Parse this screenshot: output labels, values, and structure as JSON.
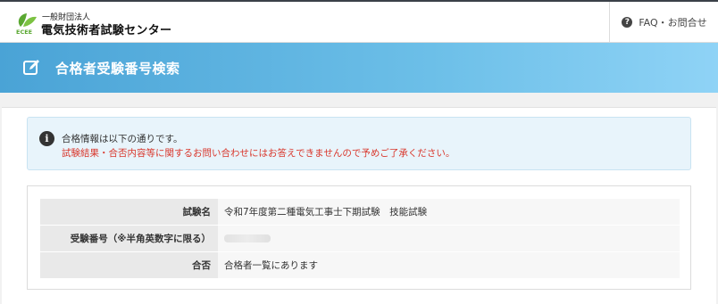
{
  "header": {
    "org_small": "一般財団法人",
    "org_name": "電気技術者試験センター",
    "logo_text": "ECEE",
    "faq_label": "FAQ・お問合せ"
  },
  "banner": {
    "title": "合格者受験番号検索"
  },
  "alert": {
    "message": "合格情報は以下の通りです。",
    "warning": "試験結果・合否内容等に関するお問い合わせにはお答えできませんので予めご了承ください。"
  },
  "result": {
    "rows": [
      {
        "label": "試験名",
        "value": "令和7年度第二種電気工事士下期試験　技能試験"
      },
      {
        "label": "受験番号（※半角英数字に限る）",
        "value": ""
      },
      {
        "label": "合否",
        "value": "合格者一覧にあります"
      }
    ]
  },
  "colors": {
    "banner_start": "#4aa3d6",
    "banner_end": "#8fd3f6",
    "warning_text": "#d9362b",
    "logo_green": "#5aa832"
  }
}
